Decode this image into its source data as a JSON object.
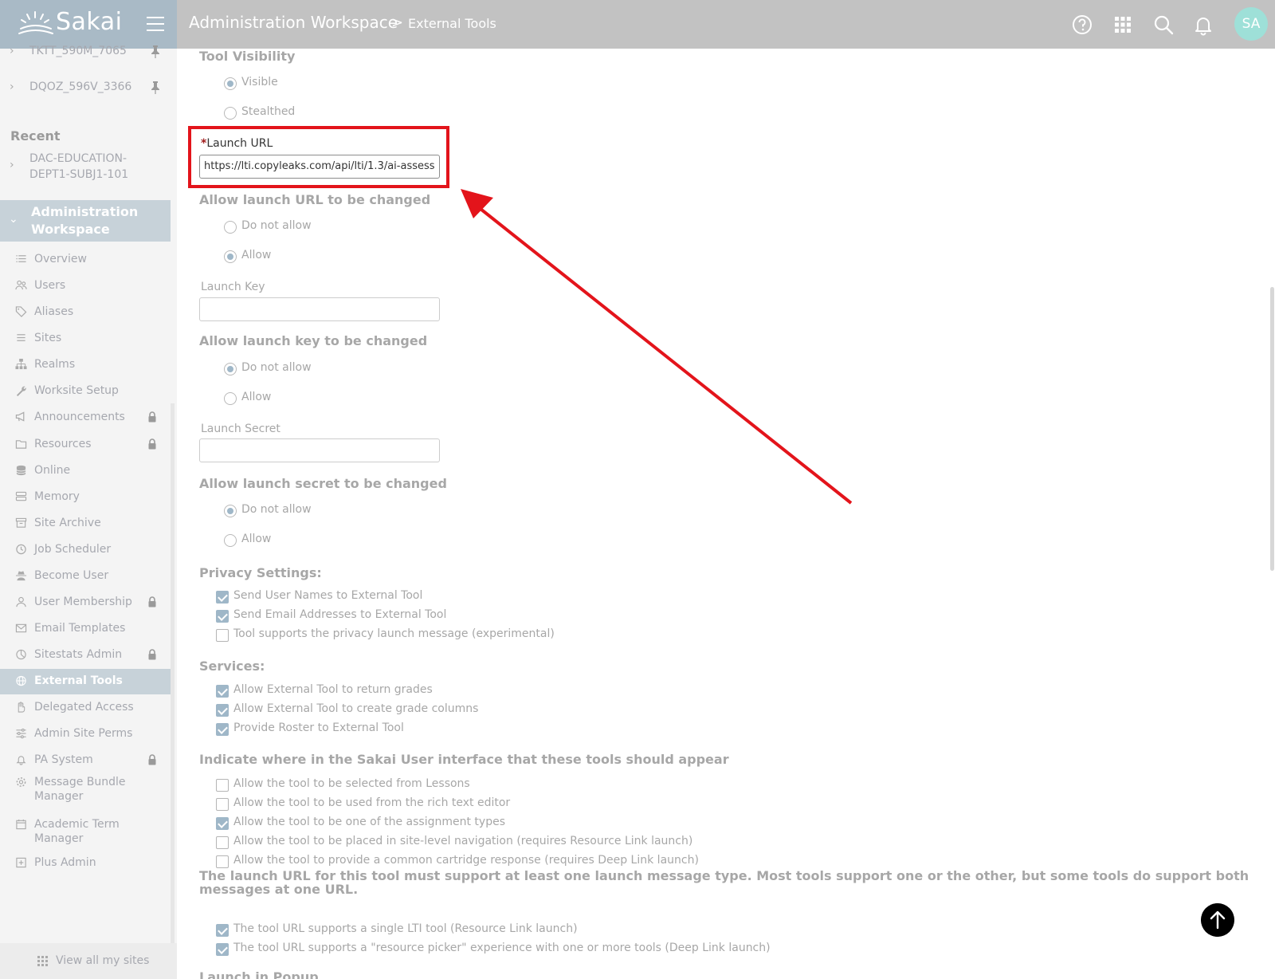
{
  "header": {
    "brand": "Sakai",
    "breadcrumb_workspace": "Administration Workspace",
    "breadcrumb_separator": ">",
    "breadcrumb_tool": "External Tools",
    "avatar_initials": "SA",
    "icons": [
      "help-icon",
      "apps-grid-icon",
      "search-icon",
      "bell-icon"
    ]
  },
  "sidebar": {
    "pinned": [
      {
        "label": "TKTT_590M_7065"
      },
      {
        "label": "DQOZ_596V_3366"
      }
    ],
    "recent_heading": "Recent",
    "recent": [
      {
        "label": "DAC-EDUCATION-DEPT1-SUBJ1-101"
      }
    ],
    "workspace_title": "Administration Workspace",
    "items": [
      {
        "label": "Overview",
        "icon": "list-icon"
      },
      {
        "label": "Users",
        "icon": "users-icon"
      },
      {
        "label": "Aliases",
        "icon": "tag-icon"
      },
      {
        "label": "Sites",
        "icon": "list-lines-icon"
      },
      {
        "label": "Realms",
        "icon": "hierarchy-icon"
      },
      {
        "label": "Worksite Setup",
        "icon": "wrench-icon"
      },
      {
        "label": "Announcements",
        "icon": "megaphone-icon",
        "locked": true
      },
      {
        "label": "Resources",
        "icon": "folder-icon",
        "locked": true
      },
      {
        "label": "Online",
        "icon": "database-icon"
      },
      {
        "label": "Memory",
        "icon": "server-icon"
      },
      {
        "label": "Site Archive",
        "icon": "archive-icon"
      },
      {
        "label": "Job Scheduler",
        "icon": "clock-icon"
      },
      {
        "label": "Become User",
        "icon": "user-secret-icon"
      },
      {
        "label": "User Membership",
        "icon": "user-icon",
        "locked": true
      },
      {
        "label": "Email Templates",
        "icon": "envelope-icon"
      },
      {
        "label": "Sitestats Admin",
        "icon": "pie-chart-icon",
        "locked": true
      },
      {
        "label": "External Tools",
        "icon": "globe-icon",
        "active": true
      },
      {
        "label": "Delegated Access",
        "icon": "hand-icon"
      },
      {
        "label": "Admin Site Perms",
        "icon": "sliders-icon"
      },
      {
        "label": "PA System",
        "icon": "bell-icon",
        "locked": true
      },
      {
        "label": "Message Bundle Manager",
        "icon": "gear-icon"
      },
      {
        "label": "Academic Term Manager",
        "icon": "calendar-icon"
      },
      {
        "label": "Plus Admin",
        "icon": "plus-square-icon"
      }
    ],
    "footer": "View all my sites"
  },
  "form": {
    "tool_visibility": {
      "heading": "Tool Visibility",
      "options": [
        "Visible",
        "Stealthed"
      ],
      "selected": "Visible"
    },
    "launch_url": {
      "required_mark": "*",
      "label": "Launch URL",
      "value": "https://lti.copyleaks.com/api/lti/1.3/ai-assess"
    },
    "allow_url_change": {
      "heading": "Allow launch URL to be changed",
      "options": [
        "Do not allow",
        "Allow"
      ],
      "selected": "Allow"
    },
    "launch_key": {
      "label": "Launch Key",
      "value": ""
    },
    "allow_key_change": {
      "heading": "Allow launch key to be changed",
      "options": [
        "Do not allow",
        "Allow"
      ],
      "selected": "Do not allow"
    },
    "launch_secret": {
      "label": "Launch Secret",
      "value": ""
    },
    "allow_secret_change": {
      "heading": "Allow launch secret to be changed",
      "options": [
        "Do not allow",
        "Allow"
      ],
      "selected": "Do not allow"
    },
    "privacy": {
      "heading": "Privacy Settings:",
      "items": [
        {
          "label": "Send User Names to External Tool",
          "checked": true
        },
        {
          "label": "Send Email Addresses to External Tool",
          "checked": true
        },
        {
          "label": "Tool supports the privacy launch message (experimental)",
          "checked": false
        }
      ]
    },
    "services": {
      "heading": "Services:",
      "items": [
        {
          "label": "Allow External Tool to return grades",
          "checked": true
        },
        {
          "label": "Allow External Tool to create grade columns",
          "checked": true
        },
        {
          "label": "Provide Roster to External Tool",
          "checked": true
        }
      ]
    },
    "placement": {
      "heading": "Indicate where in the Sakai User interface that these tools should appear",
      "items": [
        {
          "label": "Allow the tool to be selected from Lessons",
          "checked": false
        },
        {
          "label": "Allow the tool to be used from the rich text editor",
          "checked": false
        },
        {
          "label": "Allow the tool to be one of the assignment types",
          "checked": true
        },
        {
          "label": "Allow the tool to be placed in site-level navigation (requires Resource Link launch)",
          "checked": false
        },
        {
          "label": "Allow the tool to provide a common cartridge response (requires Deep Link launch)",
          "checked": false
        }
      ]
    },
    "launch_types": {
      "heading": "The launch URL for this tool must support at least one launch message type. Most tools support one or the other, but some tools do support both messages at one URL.",
      "items": [
        {
          "label": "The tool URL supports a single LTI tool (Resource Link launch)",
          "checked": true
        },
        {
          "label": "The tool URL supports a \"resource picker\" experience with one or more tools (Deep Link launch)",
          "checked": true
        }
      ]
    },
    "next_heading": "Launch in Popup"
  },
  "colors": {
    "highlight": "#e3141b",
    "header_bg": "#c2c2c2",
    "brand_bg": "#a9bac6",
    "active_nav": "#c7d2d9"
  }
}
